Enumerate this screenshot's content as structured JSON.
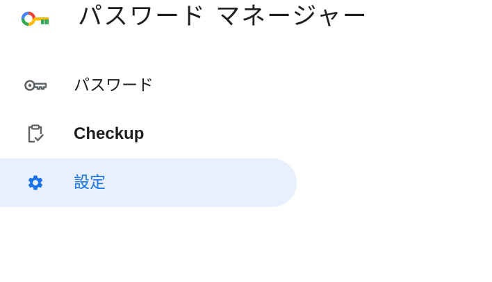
{
  "header": {
    "title": "パスワード マネージャー",
    "logo_icon": "password-manager-key-logo"
  },
  "nav": {
    "items": [
      {
        "label": "パスワード",
        "icon": "key-icon",
        "active": false
      },
      {
        "label": "Checkup",
        "icon": "clipboard-check-icon",
        "active": false
      },
      {
        "label": "設定",
        "icon": "gear-icon",
        "active": true
      }
    ]
  },
  "colors": {
    "accent": "#1a73e8",
    "active_background": "#e8f0fe",
    "text": "#1f1f1f",
    "icon_gray": "#5f6368",
    "logo_blue": "#4285f4",
    "logo_red": "#ea4335",
    "logo_yellow": "#fbbc04",
    "logo_green": "#34a853"
  }
}
